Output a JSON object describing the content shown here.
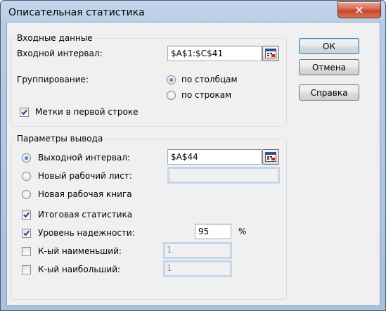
{
  "window": {
    "title": "Описательная статистика",
    "close_symbol": "✕"
  },
  "input_group": {
    "title": "Входные данные",
    "input_range_label": "Входной интервал:",
    "input_range_value": "$A$1:$C$41",
    "grouping_label": "Группирование:",
    "by_columns_label": "по столбцам",
    "by_rows_label": "по строкам",
    "grouping_selected": "по столбцам",
    "labels_first_row_label": "Метки в первой строке",
    "labels_first_row_checked": true
  },
  "output_group": {
    "title": "Параметры вывода",
    "output_range_label": "Выходной интервал:",
    "output_range_value": "$A$44",
    "new_sheet_label": "Новый рабочий лист:",
    "new_sheet_value": "",
    "new_workbook_label": "Новая рабочая книга",
    "output_selected": "Выходной интервал:",
    "summary_stats_label": "Итоговая статистика",
    "summary_stats_checked": true,
    "confidence_label": "Уровень надежности:",
    "confidence_value": "95",
    "confidence_unit": "%",
    "confidence_checked": true,
    "kth_smallest_label": "К-ый наименьший:",
    "kth_smallest_value": "1",
    "kth_smallest_checked": false,
    "kth_largest_label": "К-ый наибольший:",
    "kth_largest_value": "1",
    "kth_largest_checked": false
  },
  "buttons": {
    "ok": "ОК",
    "cancel": "Отмена",
    "help": "Справка"
  },
  "colors": {
    "title_bar": "#b9cde6",
    "close_button": "#c8452c",
    "radio_dot": "#1c5bbd",
    "checkmark": "#1b3a8c"
  },
  "icons": {
    "range_selector": "range-select-icon",
    "checkmark": "checkmark-icon",
    "close": "close-icon"
  }
}
